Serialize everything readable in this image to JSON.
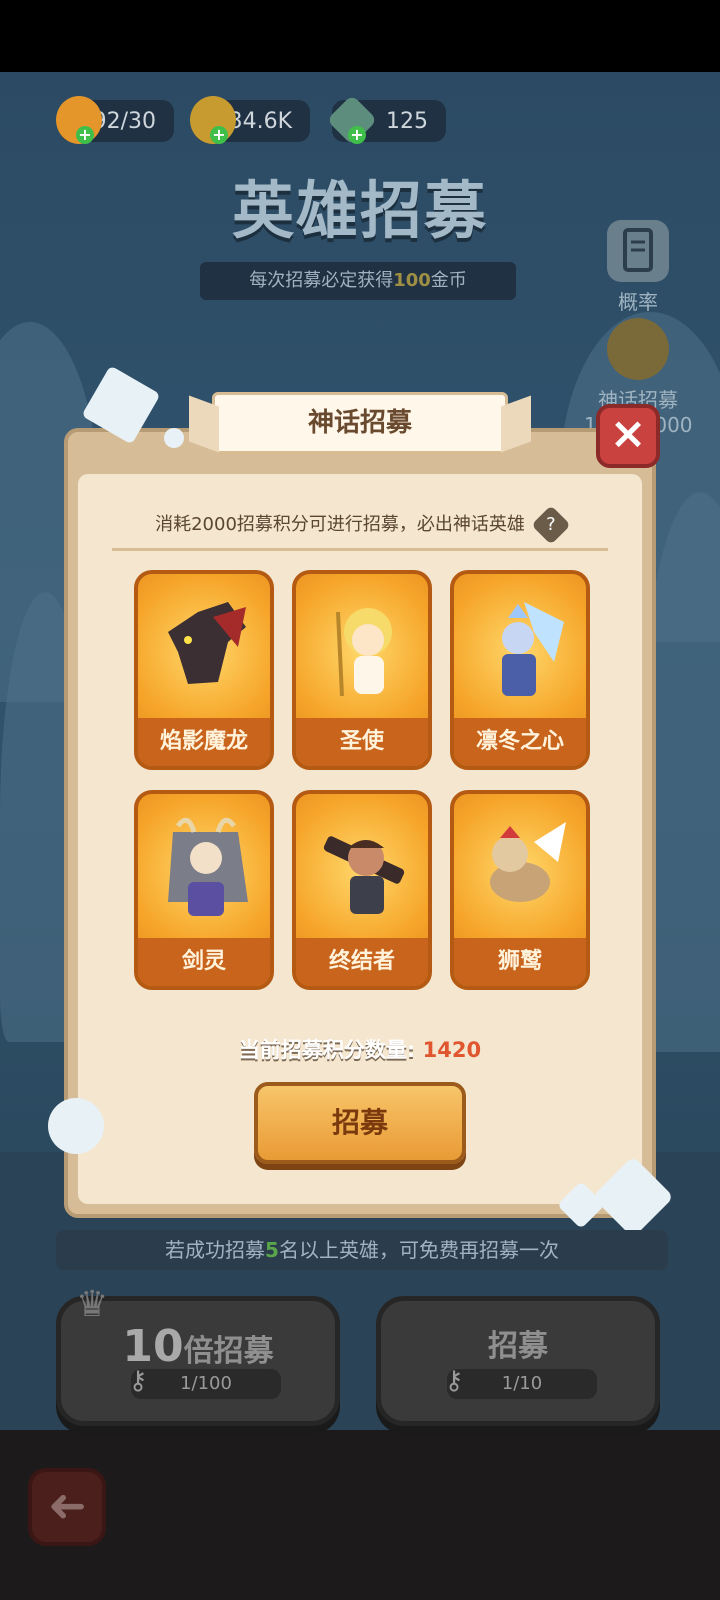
{
  "resources": [
    {
      "name": "stamina",
      "value": "92/30",
      "color": "#e4962a"
    },
    {
      "name": "gold",
      "value": "34.6K",
      "color": "#c79b2f"
    },
    {
      "name": "gem",
      "value": "125",
      "color": "#5d8d7c"
    }
  ],
  "header": {
    "title": "英雄招募",
    "subtitle_pre": "每次招募必定获得",
    "subtitle_num": "100",
    "subtitle_post": "金币"
  },
  "side": {
    "probability_label": "概率",
    "mythic_label": "神话招募",
    "mythic_progress": "1420/2000"
  },
  "dialog": {
    "title": "神话招募",
    "description": "消耗2000招募积分可进行招募，必出神话英雄",
    "help_label": "?",
    "heroes": [
      {
        "name": "焰影魔龙",
        "icon": "dragon-icon"
      },
      {
        "name": "圣使",
        "icon": "angel-icon"
      },
      {
        "name": "凛冬之心",
        "icon": "ice-queen-icon"
      },
      {
        "name": "剑灵",
        "icon": "sword-spirit-icon"
      },
      {
        "name": "终结者",
        "icon": "terminator-icon"
      },
      {
        "name": "狮鹫",
        "icon": "griffin-icon"
      }
    ],
    "points_label": "当前招募积分数量: ",
    "points_value": "1420",
    "recruit_button": "招募",
    "close_label": "×"
  },
  "bottom": {
    "notice_pre": "若成功招募",
    "notice_num": "5",
    "notice_post": "名以上英雄，可免费再招募一次",
    "ten_pull_num": "10",
    "ten_pull_label": "倍招募",
    "ten_pull_keys": "1/100",
    "single_pull_label": "招募",
    "single_pull_keys": "1/10"
  },
  "colors": {
    "accent_orange": "#e99b35",
    "points_red": "#e0562e",
    "close_red": "#c9423f"
  }
}
